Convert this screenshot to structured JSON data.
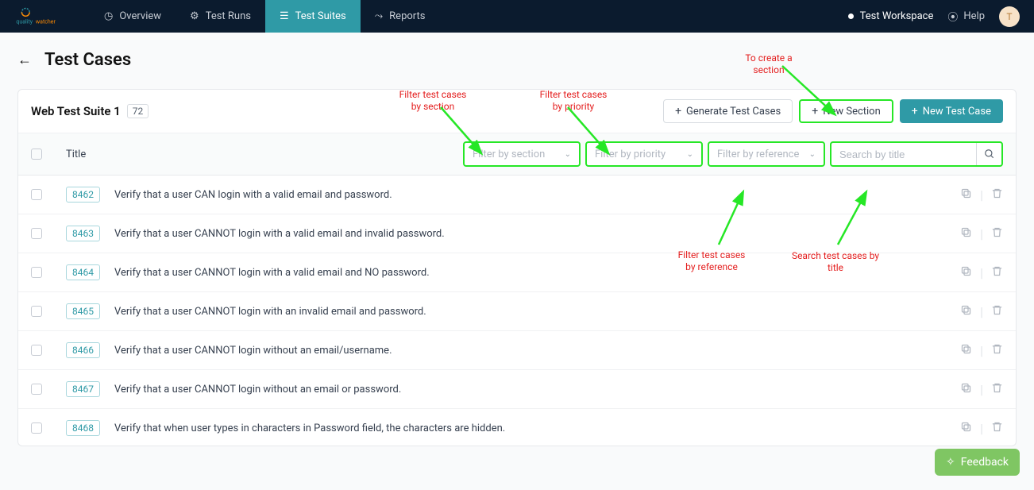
{
  "nav": {
    "overview": "Overview",
    "test_runs": "Test Runs",
    "test_suites": "Test Suites",
    "reports": "Reports",
    "workspace": "Test Workspace",
    "help": "Help",
    "avatar_initial": "T"
  },
  "page": {
    "title": "Test Cases"
  },
  "suite": {
    "name": "Web Test Suite 1",
    "count": "72"
  },
  "buttons": {
    "generate": "Generate Test Cases",
    "new_section": "New Section",
    "new_test_case": "New Test Case"
  },
  "filters": {
    "title_col": "Title",
    "section_ph": "Filter by section",
    "priority_ph": "Filter by priority",
    "reference_ph": "Filter by reference",
    "search_ph": "Search by title"
  },
  "rows": [
    {
      "id": "8462",
      "title": "Verify that a user CAN login with a valid email and password."
    },
    {
      "id": "8463",
      "title": "Verify that a user CANNOT login with a valid email and invalid password."
    },
    {
      "id": "8464",
      "title": "Verify that a user CANNOT login with a valid email and NO password."
    },
    {
      "id": "8465",
      "title": "Verify that a user CANNOT login with an invalid email and password."
    },
    {
      "id": "8466",
      "title": "Verify that a user CANNOT login without an email/username."
    },
    {
      "id": "8467",
      "title": "Verify that a user CANNOT login without an email or password."
    },
    {
      "id": "8468",
      "title": "Verify that when user types in characters in Password field, the characters are hidden."
    }
  ],
  "annotations": {
    "create_section": "To create a section",
    "filter_section": "Filter test cases by section",
    "filter_priority": "Filter test cases by priority",
    "filter_reference": "Filter test cases by reference",
    "search_title": "Search test cases by title"
  },
  "feedback": "Feedback"
}
